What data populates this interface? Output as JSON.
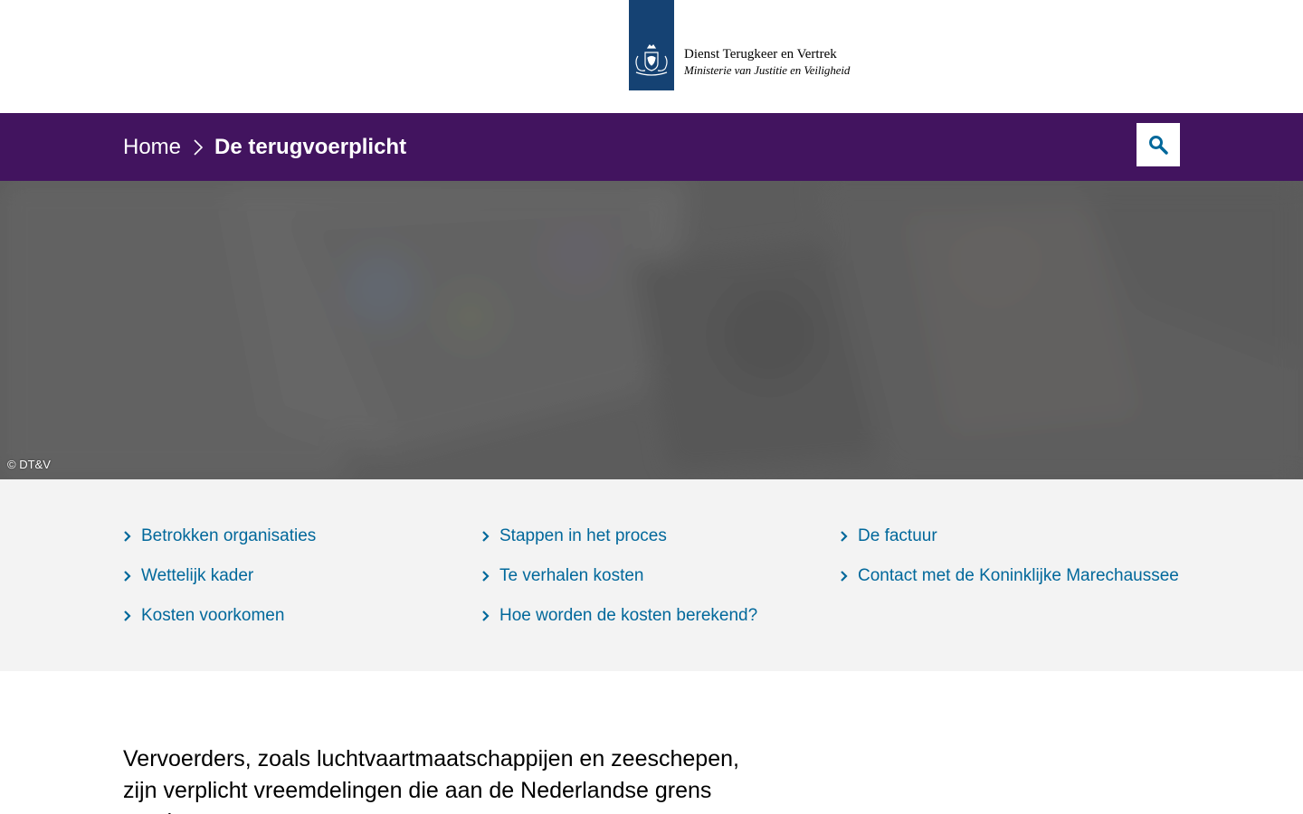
{
  "header": {
    "org_name": "Dienst Terugkeer en Vertrek",
    "ministry": "Ministerie van Justitie en Veiligheid",
    "brand_color": "#154273"
  },
  "breadcrumb": {
    "home": "Home",
    "current": "De terugvoerplicht",
    "bar_color": "#42145f"
  },
  "search": {
    "icon": "search-icon",
    "label": "Zoeken"
  },
  "hero": {
    "credit": "© DT&V"
  },
  "subnav": {
    "link_color": "#01689b",
    "columns": [
      [
        "Betrokken organisaties",
        "Wettelijk kader",
        "Kosten voorkomen"
      ],
      [
        "Stappen in het proces",
        "Te verhalen kosten",
        "Hoe worden de kosten berekend?"
      ],
      [
        "De factuur",
        "Contact met de Koninklijke Marechaussee"
      ]
    ]
  },
  "intro": {
    "text": "Vervoerders, zoals luchtvaartmaatschappijen en zeeschepen, zijn verplicht vreemdelingen die aan de Nederlandse grens worden"
  }
}
